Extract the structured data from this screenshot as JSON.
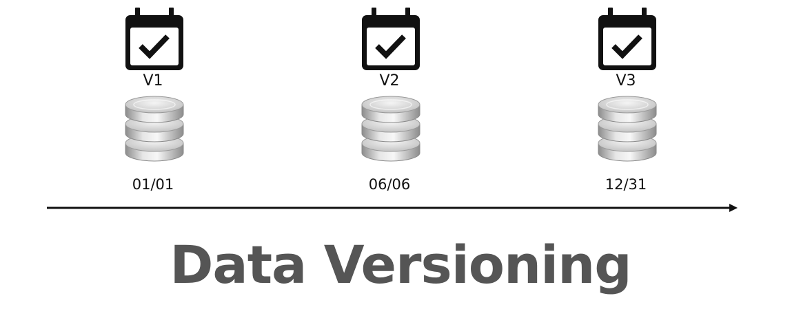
{
  "versions": [
    {
      "label": "V1",
      "date": "01/01",
      "icon": "calendar-check-icon",
      "db_icon": "database-icon"
    },
    {
      "label": "V2",
      "date": "06/06",
      "icon": "calendar-check-icon",
      "db_icon": "database-icon"
    },
    {
      "label": "V3",
      "date": "12/31",
      "icon": "calendar-check-icon",
      "db_icon": "database-icon"
    }
  ],
  "title": "Data Versioning",
  "colors": {
    "icon": "#111111",
    "title": "#555555",
    "db_light": "#eeeeee",
    "db_dark": "#8a8a8a"
  }
}
